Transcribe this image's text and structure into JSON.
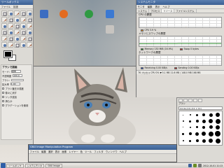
{
  "desktop": {
    "icons": [
      {
        "label": "",
        "color": "#3c6dc1"
      },
      {
        "label": "",
        "color": "#e36b1f"
      },
      {
        "label": "",
        "color": "#2f9a43"
      },
      {
        "label": "",
        "color": "#3b79d2"
      },
      {
        "label": "",
        "color": "#c7c4c0"
      }
    ]
  },
  "toolbox": {
    "title": "ツールボックス",
    "menu": [
      "ファイル",
      "拡張"
    ],
    "tool_icons": [
      "rect-select-icon",
      "ellipse-select-icon",
      "lasso-icon",
      "fuzzy-select-icon",
      "color-select-icon",
      "scissors-icon",
      "paths-icon",
      "color-picker-icon",
      "zoom-icon",
      "measure-icon",
      "move-icon",
      "align-icon",
      "crop-icon",
      "rotate-icon",
      "scale-icon",
      "shear-icon",
      "perspective-icon",
      "flip-icon",
      "text-icon",
      "bucket-fill-icon",
      "blend-icon",
      "pencil-icon",
      "paintbrush-icon",
      "eraser-icon",
      "airbrush-icon",
      "ink-icon",
      "clone-icon",
      "heal-icon",
      "smudge-icon",
      "dodge-icon"
    ],
    "fg_color": "#000000",
    "bg_color": "#ffffff",
    "options_title": "ブラシで描画",
    "options": [
      {
        "label": "モード:",
        "value": "標準"
      },
      {
        "label": "不透明度",
        "value": "100.0"
      },
      {
        "label": "ブラシ:",
        "value": ""
      },
      {
        "label": "拡大率",
        "value": "1.00"
      }
    ],
    "checkboxes": [
      "ブラシ筆圧の感度",
      "徐々に消す",
      "ジッタ追加",
      "滑らか",
      "グラデーションを使用"
    ]
  },
  "sysmon": {
    "title": "システムモニタ",
    "menu": [
      "モニタ",
      "編集",
      "表示",
      "ヘルプ"
    ],
    "tabs": [
      "システム",
      "プロセス",
      "リソース",
      "ファイルシステム"
    ],
    "active_tab": 2,
    "cpu": {
      "label": "CPU の履歴",
      "legend": "CPU 3.9 %",
      "color": "#e3881f",
      "values": [
        0.05,
        0.08,
        0.04,
        0.06,
        0.05,
        0.1,
        0.04,
        0.05,
        0.06,
        0.04
      ]
    },
    "memory": {
      "label": "メモリとスワップの履歴",
      "mem_legend": "Memory  130 MiB (16.9%)",
      "mem_color": "#2b8a2b",
      "swap_legend": "Swap  0 bytes",
      "swap_color": "#c03030",
      "values": [
        0.35,
        0.35,
        0.36,
        0.36,
        0.36,
        0.37,
        0.37,
        0.37,
        0.37,
        0.37
      ]
    },
    "network": {
      "label": "ネットワークの履歴",
      "recv_legend": "Receiving  0.00 KiB/s",
      "recv_color": "#2e55c4",
      "send_legend": "Sending  0.00 KiB/s",
      "send_color": "#c03030",
      "values": [
        0.0,
        0.0,
        0.02,
        0.0,
        0.0,
        0.01,
        0.0,
        0.0,
        0.0,
        0.0
      ]
    },
    "process_bar": "76 プロセス  CPU  0%  ▼ 5.1 MB  11.6 MB / 148.0 MB  168 MB"
  },
  "dock": {
    "title": "ブラシ",
    "brush_box": "Circle (11) (11 × 11)",
    "brushes": [
      1,
      2,
      3,
      4,
      5,
      6,
      2,
      3,
      4,
      5,
      6,
      7,
      1,
      2,
      3,
      4,
      5,
      6,
      3,
      4,
      5,
      6,
      7,
      8,
      2,
      3,
      4,
      5,
      6,
      7
    ]
  },
  "gimpwin": {
    "title": "GNU Image Manipulation Program",
    "menu": [
      "ファイル",
      "編集",
      "選択",
      "表示",
      "画像",
      "レイヤー",
      "色",
      "ツール",
      "フィルタ",
      "ウィンドウ",
      "ヘルプ"
    ]
  },
  "taskbar": {
    "buttons": [
      "ツールボック",
      "システムモニタ",
      "GNU Image"
    ],
    "clock": "2012-10-01 11:13"
  }
}
